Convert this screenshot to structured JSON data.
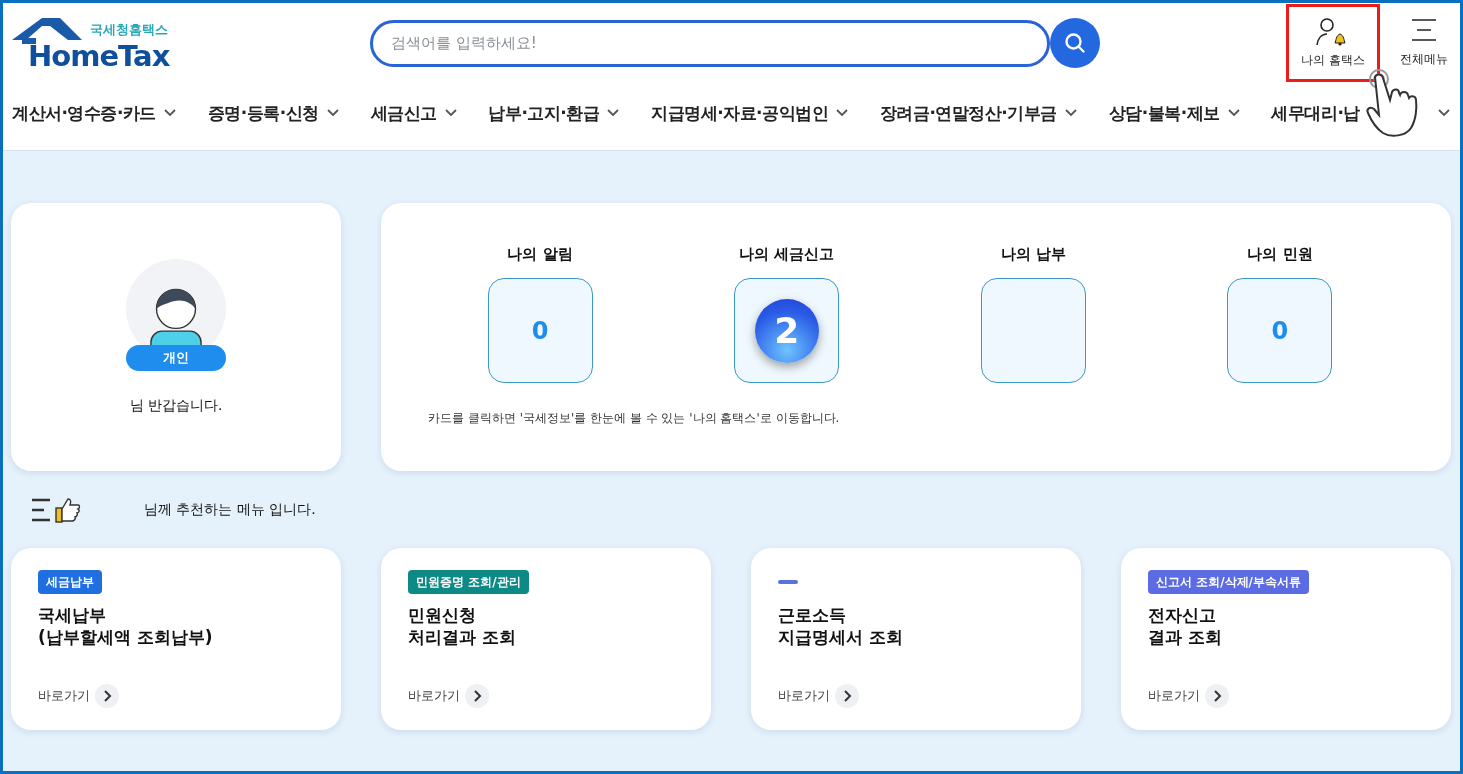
{
  "header": {
    "logo": {
      "subtitle": "국세청홈택스",
      "title": "HomeTax"
    },
    "search": {
      "placeholder": "검색어를 입력하세요!"
    },
    "my_hometax": {
      "label": "나의 홈택스",
      "highlighted": true
    },
    "all_menu": {
      "label": "전체메뉴"
    }
  },
  "nav": [
    {
      "label": "계산서·영수증·카드"
    },
    {
      "label": "증명·등록·신청"
    },
    {
      "label": "세금신고"
    },
    {
      "label": "납부·고지·환급"
    },
    {
      "label": "지급명세·자료·공익법인"
    },
    {
      "label": "장려금·연말정산·기부금"
    },
    {
      "label": "상담·불복·제보"
    },
    {
      "label": "세무대리·납"
    }
  ],
  "profile": {
    "badge": "개인",
    "greeting": "님 반갑습니다."
  },
  "summary": {
    "tiles": [
      {
        "title": "나의 알림",
        "kind": "number",
        "value": "0"
      },
      {
        "title": "나의 세금신고",
        "kind": "badge",
        "value": "2"
      },
      {
        "title": "나의 납부",
        "kind": "empty"
      },
      {
        "title": "나의 민원",
        "kind": "number",
        "value": "0"
      }
    ],
    "note": "카드를 클릭하면 '국세정보'를 한눈에 볼 수 있는 '나의 홈택스'로 이동합니다."
  },
  "recommend": {
    "heading": "님께 추천하는 메뉴 입니다.",
    "cards": [
      {
        "kind": "tag",
        "tag": "세금납부",
        "color": "#1f6fe0",
        "title": [
          "국세납부",
          "(납부할세액 조회납부)"
        ],
        "link": "바로가기"
      },
      {
        "kind": "tag",
        "tag": "민원증명 조회/관리",
        "color": "#0e8a86",
        "title": [
          "민원신청",
          "처리결과 조회"
        ],
        "link": "바로가기"
      },
      {
        "kind": "dash",
        "color": "#5b72dc",
        "title": [
          "근로소득",
          "지급명세서 조회"
        ],
        "link": "바로가기"
      },
      {
        "kind": "tag",
        "tag": "신고서 조회/삭제/부속서류",
        "color": "#5b6be2",
        "title": [
          "전자신고",
          "결과 조회"
        ],
        "link": "바로가기"
      }
    ]
  }
}
